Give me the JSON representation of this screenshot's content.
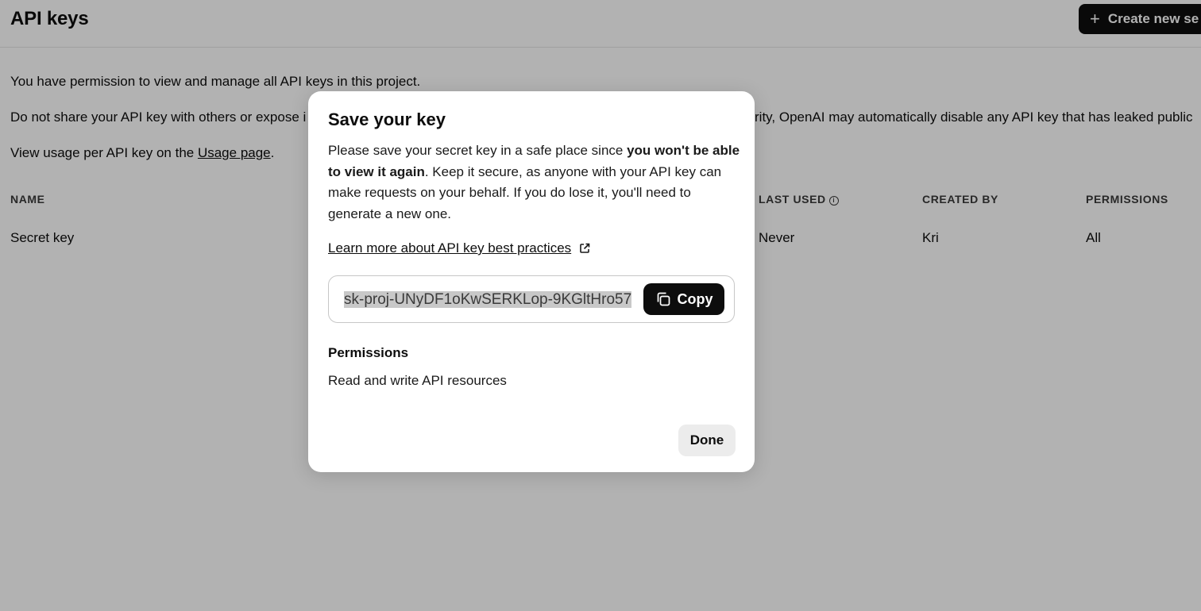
{
  "page": {
    "title": "API keys",
    "create_button_label": "Create new se",
    "intro_permission": "You have permission to view and manage all API keys in this project.",
    "warning_left": "Do not share your API key with others or expose i",
    "warning_right": "rity, OpenAI may automatically disable any API key that has leaked public",
    "usage_prefix": "View usage per API key on the ",
    "usage_link": "Usage page",
    "usage_suffix": "."
  },
  "table": {
    "columns": {
      "name": "NAME",
      "last_used": "LAST USED",
      "created_by": "CREATED BY",
      "permissions": "PERMISSIONS"
    },
    "rows": [
      {
        "name": "Secret key",
        "last_used": "Never",
        "created_by": "Kri",
        "permissions": "All"
      }
    ]
  },
  "modal": {
    "title": "Save your key",
    "body_prefix": "Please save your secret key in a safe place since ",
    "body_bold": "you won't be able to view it again",
    "body_suffix": ". Keep it secure, as anyone with your API key can make requests on your behalf. If you do lose it, you'll need to generate a new one.",
    "learn_more": "Learn more about API key best practices",
    "key_value": "sk-proj-UNyDF1oKwSERKLop-9KGltHro57",
    "copy_label": "Copy",
    "permissions_heading": "Permissions",
    "permissions_value": "Read and write API resources",
    "done_label": "Done"
  },
  "icons": {
    "plus": "plus-icon",
    "info": "info-icon",
    "external_link": "external-link-icon",
    "copy": "copy-icon"
  },
  "colors": {
    "primary_button": "#0d0d0d",
    "overlay": "rgba(0,0,0,0.30)",
    "done_button": "#ececec"
  }
}
